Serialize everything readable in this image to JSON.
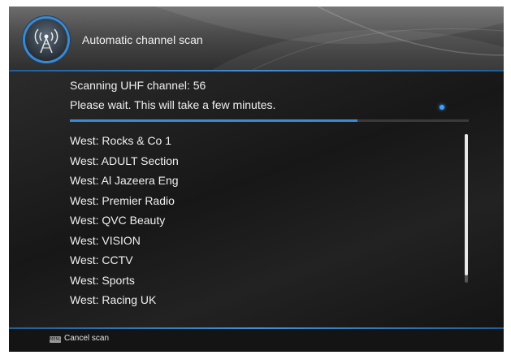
{
  "header": {
    "title": "Automatic channel scan",
    "icon": "antenna-broadcast-icon"
  },
  "scan": {
    "status_line": "Scanning UHF channel: 56",
    "wait_message": "Please wait. This will take a few minutes.",
    "progress_fraction": 0.72
  },
  "channels": [
    "West: Rocks & Co 1",
    "West: ADULT Section",
    "West: Al Jazeera Eng",
    "West: Premier Radio",
    "West: QVC Beauty",
    "West: VISION",
    "West: CCTV",
    "West: Sports",
    "West: Racing UK"
  ],
  "list_scroll": {
    "thumb_start_fraction": 0.0,
    "thumb_end_fraction": 0.95
  },
  "footer": {
    "cancel_label": "Cancel scan",
    "key_icon": "menu-key-icon"
  },
  "colors": {
    "accent": "#3a8ad6",
    "background": "#1c1c1c",
    "text": "#f0f0f0"
  }
}
